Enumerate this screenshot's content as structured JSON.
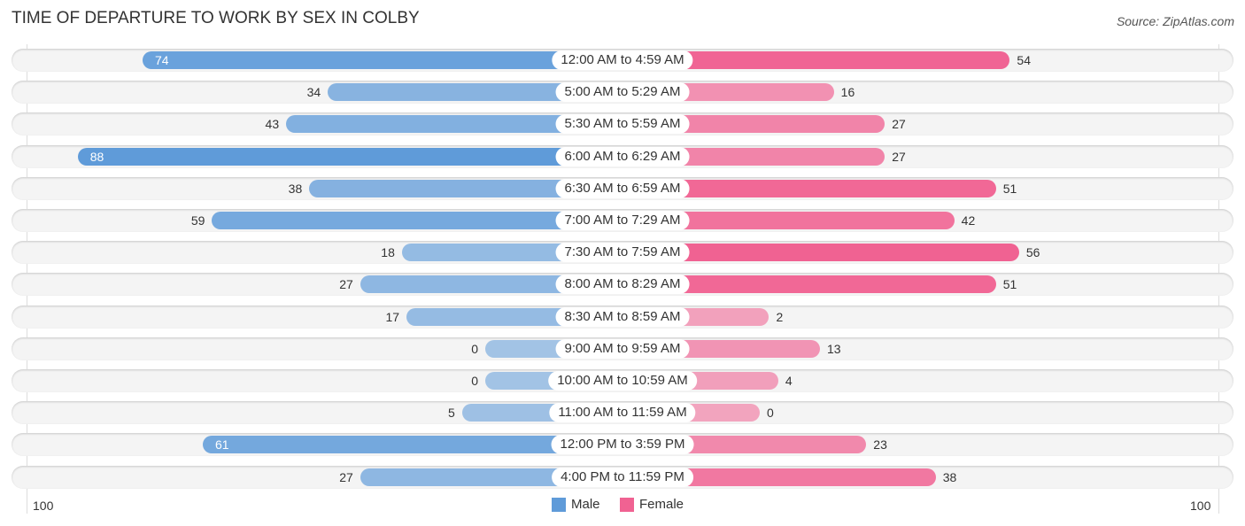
{
  "chart_data": {
    "type": "bar",
    "title": "TIME OF DEPARTURE TO WORK BY SEX IN COLBY",
    "source": "Source: ZipAtlas.com",
    "categories": [
      "12:00 AM to 4:59 AM",
      "5:00 AM to 5:29 AM",
      "5:30 AM to 5:59 AM",
      "6:00 AM to 6:29 AM",
      "6:30 AM to 6:59 AM",
      "7:00 AM to 7:29 AM",
      "7:30 AM to 7:59 AM",
      "8:00 AM to 8:29 AM",
      "8:30 AM to 8:59 AM",
      "9:00 AM to 9:59 AM",
      "10:00 AM to 10:59 AM",
      "11:00 AM to 11:59 AM",
      "12:00 PM to 3:59 PM",
      "4:00 PM to 11:59 PM"
    ],
    "series": [
      {
        "name": "Male",
        "color": "#5f9bd9",
        "values": [
          74,
          34,
          43,
          88,
          38,
          59,
          18,
          27,
          17,
          0,
          0,
          5,
          61,
          27
        ]
      },
      {
        "name": "Female",
        "color": "#f06292",
        "values": [
          54,
          16,
          27,
          27,
          51,
          42,
          56,
          51,
          2,
          13,
          4,
          0,
          23,
          38
        ]
      }
    ],
    "axis_left_label": "100",
    "axis_right_label": "100",
    "legend": [
      "Male",
      "Female"
    ],
    "legend_position": "bottom-center"
  }
}
